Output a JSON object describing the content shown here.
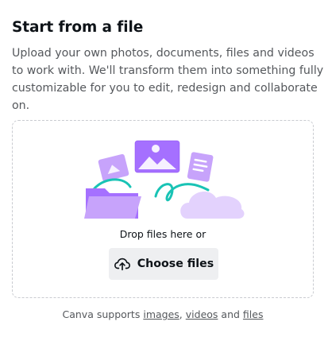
{
  "panel": {
    "title": "Start from a file",
    "description": "Upload your own photos, documents, files and videos to work with. We'll transform them into something fully customizable for you to edit, redesign and collaborate on."
  },
  "dropzone": {
    "drop_text": "Drop files here or",
    "choose_button_label": "Choose files",
    "choose_button_icon": "upload-cloud-icon",
    "illustration": "folder-cloud-files-illustration"
  },
  "footer": {
    "prefix": "Canva supports",
    "link_images": "images",
    "separator": ",",
    "link_videos": "videos",
    "conjunction": "and",
    "link_files": "files"
  },
  "colors": {
    "accent_purple": "#a570ff",
    "accent_teal": "#19c3b5",
    "button_bg": "#eeeff1",
    "text_primary": "#0e1318",
    "text_secondary": "#55585c",
    "dashed_border": "#c9cbd0"
  }
}
